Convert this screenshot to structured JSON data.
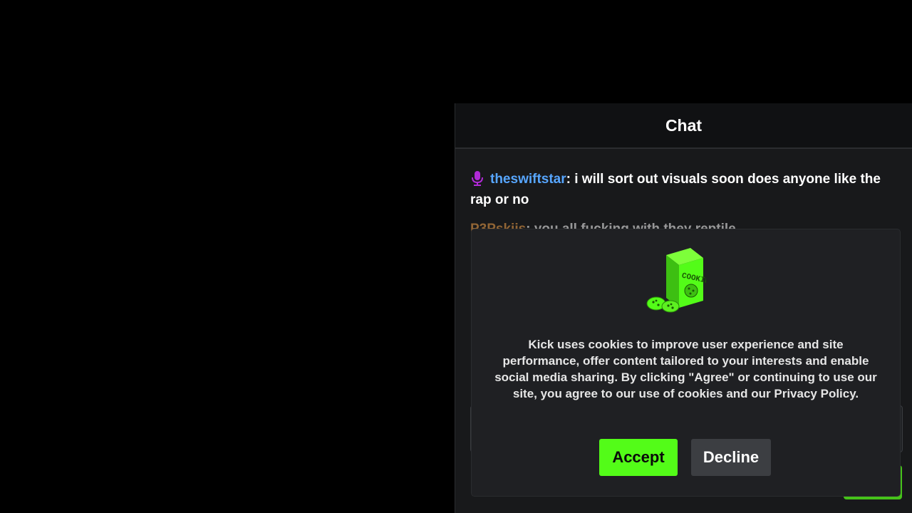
{
  "chat": {
    "title": "Chat",
    "messages": [
      {
        "username": "theswiftstar",
        "separator": ": ",
        "text": "i will sort out visuals soon does anyone like the rap or no",
        "badge_icon": "microphone-icon"
      },
      {
        "username": "P3Pskiis",
        "separator": ": ",
        "text": "you all fucking with they reptile"
      }
    ]
  },
  "cookie_banner": {
    "icon": "cookie-box-icon",
    "message": "Kick uses cookies to improve user experience and site performance, offer content tailored to your interests and enable social media sharing. By clicking \"Agree\" or continuing to use our site, you agree to our use of cookies and our Privacy Policy.",
    "accept_label": "Accept",
    "decline_label": "Decline"
  },
  "colors": {
    "accent": "#53fc18",
    "username_blue": "#57a6ff",
    "username_orange": "#f5a34b",
    "badge_purple": "#b02ad6"
  }
}
